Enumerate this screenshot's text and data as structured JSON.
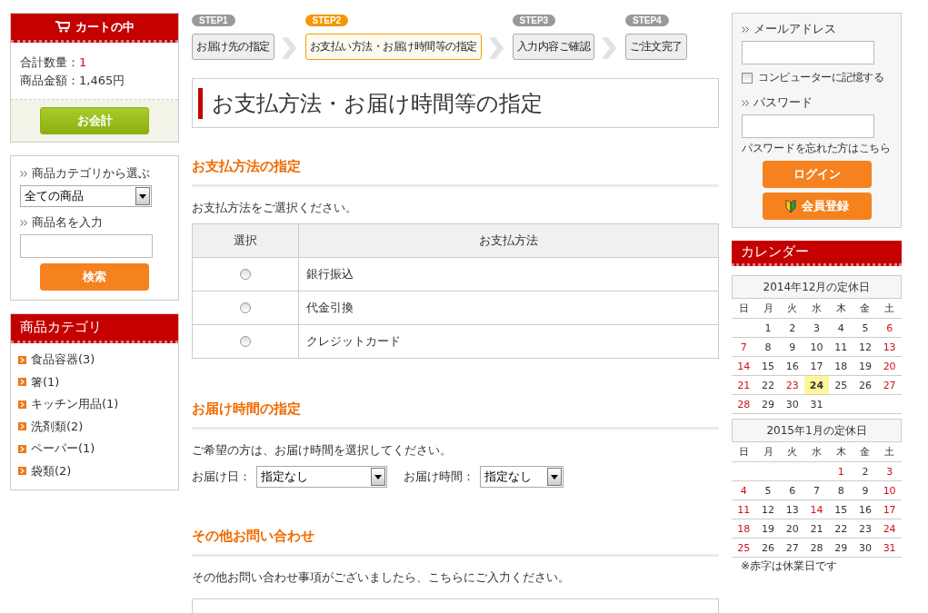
{
  "cart": {
    "title": "カートの中",
    "quantity_label": "合計数量：",
    "quantity": "1",
    "amount_label": "商品金額：",
    "amount": "1,465円",
    "checkout_button": "お会計"
  },
  "search": {
    "category_label": "商品カテゴリから選ぶ",
    "category_value": "全ての商品",
    "name_label": "商品名を入力",
    "button": "検索"
  },
  "categories": {
    "title": "商品カテゴリ",
    "items": [
      "食品容器(3)",
      "箸(1)",
      "キッチン用品(1)",
      "洗剤類(2)",
      "ペーパー(1)",
      "袋類(2)"
    ]
  },
  "steps": [
    {
      "step": "STEP1",
      "label": "お届け先の指定",
      "selected": false
    },
    {
      "step": "STEP2",
      "label": "お支払い方法・お届け時間等の指定",
      "selected": true
    },
    {
      "step": "STEP3",
      "label": "入力内容ご確認",
      "selected": false
    },
    {
      "step": "STEP4",
      "label": "ご注文完了",
      "selected": false
    }
  ],
  "page_title": "お支払方法・お届け時間等の指定",
  "payment": {
    "heading": "お支払方法の指定",
    "intro": "お支払方法をご選択ください。",
    "columns": [
      "選択",
      "お支払方法"
    ],
    "rows": [
      {
        "method": "銀行振込",
        "selected": false
      },
      {
        "method": "代金引換",
        "selected": false
      },
      {
        "method": "クレジットカード",
        "selected": false
      }
    ]
  },
  "delivery": {
    "heading": "お届け時間の指定",
    "intro": "ご希望の方は、お届け時間を選択してください。",
    "date_label": "お届け日：",
    "date_value": "指定なし",
    "time_label": "お届け時間：",
    "time_value": "指定なし"
  },
  "inquiry": {
    "heading": "その他お問い合わせ",
    "intro": "その他お問い合わせ事項がございましたら、こちらにご入力ください。"
  },
  "login": {
    "email_label": "メールアドレス",
    "remember_label": "コンピューターに記憶する",
    "remember_checked": false,
    "password_label": "パスワード",
    "forgot_link": "パスワードを忘れた方はこちら",
    "login_button": "ログイン",
    "register_button": "会員登録"
  },
  "calendar": {
    "title": "カレンダー",
    "note": "※赤字は休業日です",
    "months": [
      {
        "title": "2014年12月の定休日",
        "weekdays": [
          "日",
          "月",
          "火",
          "水",
          "木",
          "金",
          "土"
        ],
        "weeks": [
          [
            {
              "kind": "blank"
            },
            {
              "kind": "day",
              "d": "1",
              "holiday": false,
              "today": false
            },
            {
              "kind": "day",
              "d": "2",
              "holiday": false,
              "today": false
            },
            {
              "kind": "day",
              "d": "3",
              "holiday": false,
              "today": false
            },
            {
              "kind": "day",
              "d": "4",
              "holiday": false,
              "today": false
            },
            {
              "kind": "day",
              "d": "5",
              "holiday": false,
              "today": false
            },
            {
              "kind": "day",
              "d": "6",
              "holiday": true,
              "today": false
            }
          ],
          [
            {
              "kind": "day",
              "d": "7",
              "holiday": true,
              "today": false
            },
            {
              "kind": "day",
              "d": "8",
              "holiday": false,
              "today": false
            },
            {
              "kind": "day",
              "d": "9",
              "holiday": false,
              "today": false
            },
            {
              "kind": "day",
              "d": "10",
              "holiday": false,
              "today": false
            },
            {
              "kind": "day",
              "d": "11",
              "holiday": false,
              "today": false
            },
            {
              "kind": "day",
              "d": "12",
              "holiday": false,
              "today": false
            },
            {
              "kind": "day",
              "d": "13",
              "holiday": true,
              "today": false
            }
          ],
          [
            {
              "kind": "day",
              "d": "14",
              "holiday": true,
              "today": false
            },
            {
              "kind": "day",
              "d": "15",
              "holiday": false,
              "today": false
            },
            {
              "kind": "day",
              "d": "16",
              "holiday": false,
              "today": false
            },
            {
              "kind": "day",
              "d": "17",
              "holiday": false,
              "today": false
            },
            {
              "kind": "day",
              "d": "18",
              "holiday": false,
              "today": false
            },
            {
              "kind": "day",
              "d": "19",
              "holiday": false,
              "today": false
            },
            {
              "kind": "day",
              "d": "20",
              "holiday": true,
              "today": false
            }
          ],
          [
            {
              "kind": "day",
              "d": "21",
              "holiday": true,
              "today": false
            },
            {
              "kind": "day",
              "d": "22",
              "holiday": false,
              "today": false
            },
            {
              "kind": "day",
              "d": "23",
              "holiday": true,
              "today": false
            },
            {
              "kind": "day",
              "d": "24",
              "holiday": false,
              "today": true
            },
            {
              "kind": "day",
              "d": "25",
              "holiday": false,
              "today": false
            },
            {
              "kind": "day",
              "d": "26",
              "holiday": false,
              "today": false
            },
            {
              "kind": "day",
              "d": "27",
              "holiday": true,
              "today": false
            }
          ],
          [
            {
              "kind": "day",
              "d": "28",
              "holiday": true,
              "today": false
            },
            {
              "kind": "day",
              "d": "29",
              "holiday": false,
              "today": false
            },
            {
              "kind": "day",
              "d": "30",
              "holiday": false,
              "today": false
            },
            {
              "kind": "day",
              "d": "31",
              "holiday": false,
              "today": false
            },
            {
              "kind": "blank"
            },
            {
              "kind": "blank"
            },
            {
              "kind": "blank"
            }
          ]
        ]
      },
      {
        "title": "2015年1月の定休日",
        "weekdays": [
          "日",
          "月",
          "火",
          "水",
          "木",
          "金",
          "土"
        ],
        "weeks": [
          [
            {
              "kind": "blank"
            },
            {
              "kind": "blank"
            },
            {
              "kind": "blank"
            },
            {
              "kind": "blank"
            },
            {
              "kind": "day",
              "d": "1",
              "holiday": true,
              "today": false
            },
            {
              "kind": "day",
              "d": "2",
              "holiday": false,
              "today": false
            },
            {
              "kind": "day",
              "d": "3",
              "holiday": true,
              "today": false
            }
          ],
          [
            {
              "kind": "day",
              "d": "4",
              "holiday": true,
              "today": false
            },
            {
              "kind": "day",
              "d": "5",
              "holiday": false,
              "today": false
            },
            {
              "kind": "day",
              "d": "6",
              "holiday": false,
              "today": false
            },
            {
              "kind": "day",
              "d": "7",
              "holiday": false,
              "today": false
            },
            {
              "kind": "day",
              "d": "8",
              "holiday": false,
              "today": false
            },
            {
              "kind": "day",
              "d": "9",
              "holiday": false,
              "today": false
            },
            {
              "kind": "day",
              "d": "10",
              "holiday": true,
              "today": false
            }
          ],
          [
            {
              "kind": "day",
              "d": "11",
              "holiday": true,
              "today": false
            },
            {
              "kind": "day",
              "d": "12",
              "holiday": false,
              "today": false
            },
            {
              "kind": "day",
              "d": "13",
              "holiday": false,
              "today": false
            },
            {
              "kind": "day",
              "d": "14",
              "holiday": true,
              "today": false
            },
            {
              "kind": "day",
              "d": "15",
              "holiday": false,
              "today": false
            },
            {
              "kind": "day",
              "d": "16",
              "holiday": false,
              "today": false
            },
            {
              "kind": "day",
              "d": "17",
              "holiday": true,
              "today": false
            }
          ],
          [
            {
              "kind": "day",
              "d": "18",
              "holiday": true,
              "today": false
            },
            {
              "kind": "day",
              "d": "19",
              "holiday": false,
              "today": false
            },
            {
              "kind": "day",
              "d": "20",
              "holiday": false,
              "today": false
            },
            {
              "kind": "day",
              "d": "21",
              "holiday": false,
              "today": false
            },
            {
              "kind": "day",
              "d": "22",
              "holiday": false,
              "today": false
            },
            {
              "kind": "day",
              "d": "23",
              "holiday": false,
              "today": false
            },
            {
              "kind": "day",
              "d": "24",
              "holiday": true,
              "today": false
            }
          ],
          [
            {
              "kind": "day",
              "d": "25",
              "holiday": true,
              "today": false
            },
            {
              "kind": "day",
              "d": "26",
              "holiday": false,
              "today": false
            },
            {
              "kind": "day",
              "d": "27",
              "holiday": false,
              "today": false
            },
            {
              "kind": "day",
              "d": "28",
              "holiday": false,
              "today": false
            },
            {
              "kind": "day",
              "d": "29",
              "holiday": false,
              "today": false
            },
            {
              "kind": "day",
              "d": "30",
              "holiday": false,
              "today": false
            },
            {
              "kind": "day",
              "d": "31",
              "holiday": true,
              "today": false
            }
          ]
        ]
      }
    ]
  }
}
